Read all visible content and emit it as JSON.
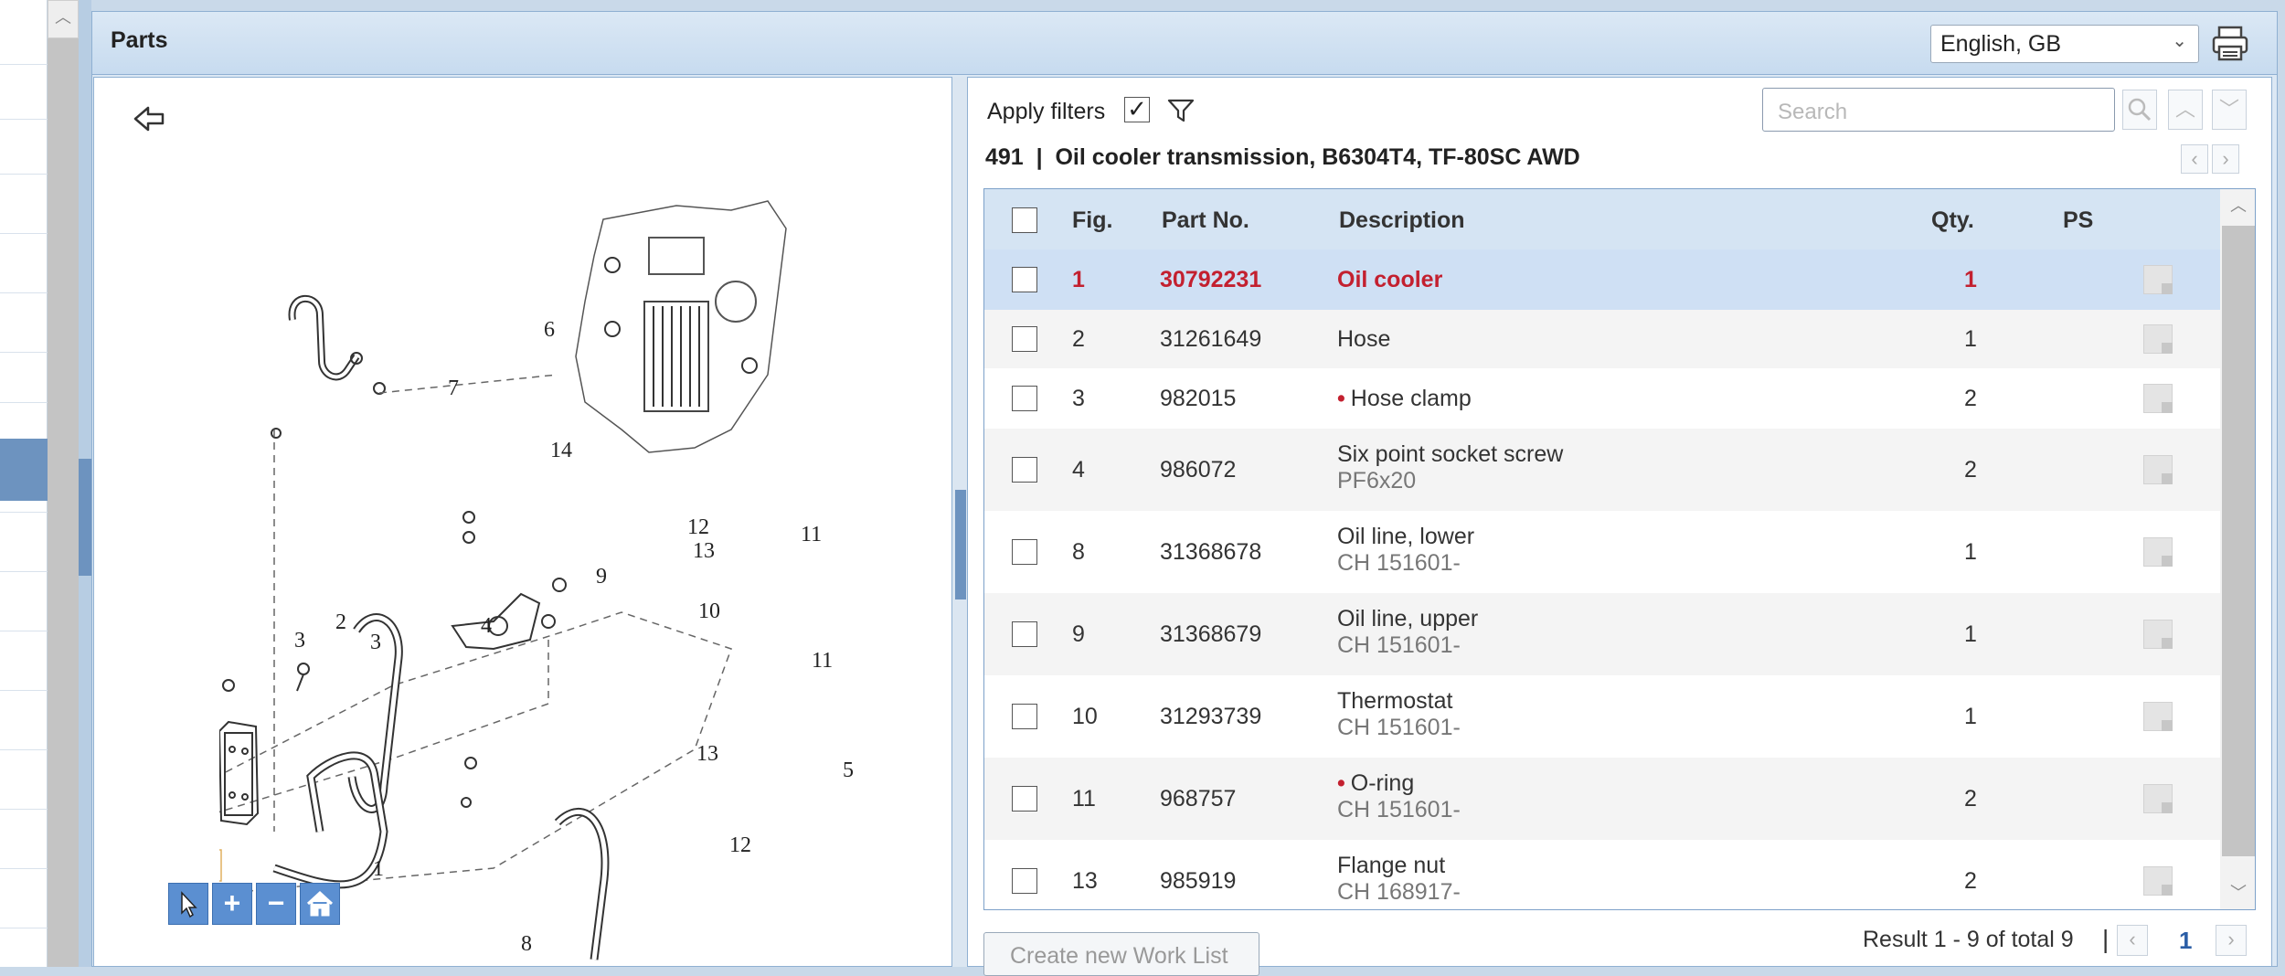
{
  "header": {
    "title": "Parts",
    "language": "English, GB"
  },
  "filters": {
    "apply_label": "Apply filters",
    "apply_checked": true,
    "search_placeholder": "Search"
  },
  "part": {
    "title": "491  |  Oil cooler transmission, B6304T4, TF-80SC AWD"
  },
  "table": {
    "columns": [
      "Fig.",
      "Part No.",
      "Description",
      "Qty.",
      "PS"
    ],
    "rows": [
      {
        "fig": "1",
        "part_no": "30792231",
        "desc": "Oil cooler",
        "sub": "",
        "qty": "1",
        "dot": false,
        "selected": true
      },
      {
        "fig": "2",
        "part_no": "31261649",
        "desc": "Hose",
        "sub": "",
        "qty": "1",
        "dot": false,
        "selected": false
      },
      {
        "fig": "3",
        "part_no": "982015",
        "desc": "Hose clamp",
        "sub": "",
        "qty": "2",
        "dot": true,
        "selected": false
      },
      {
        "fig": "4",
        "part_no": "986072",
        "desc": "Six point socket screw",
        "sub": "PF6x20",
        "qty": "2",
        "dot": false,
        "selected": false
      },
      {
        "fig": "8",
        "part_no": "31368678",
        "desc": "Oil line, lower",
        "sub": "CH 151601-",
        "qty": "1",
        "dot": false,
        "selected": false
      },
      {
        "fig": "9",
        "part_no": "31368679",
        "desc": "Oil line, upper",
        "sub": "CH 151601-",
        "qty": "1",
        "dot": false,
        "selected": false
      },
      {
        "fig": "10",
        "part_no": "31293739",
        "desc": "Thermostat",
        "sub": "CH 151601-",
        "qty": "1",
        "dot": false,
        "selected": false
      },
      {
        "fig": "11",
        "part_no": "968757",
        "desc": "O-ring",
        "sub": "CH 151601-",
        "qty": "2",
        "dot": true,
        "selected": false
      },
      {
        "fig": "13",
        "part_no": "985919",
        "desc": "Flange nut",
        "sub": "CH 168917-",
        "qty": "2",
        "dot": false,
        "selected": false
      }
    ]
  },
  "footer": {
    "worklist_label": "Create new Work List",
    "result": "Result 1 - 9 of total 9",
    "separator": "|",
    "page": "1"
  },
  "diagram": {
    "callouts": [
      "6",
      "7",
      "14",
      "12",
      "13",
      "11",
      "9",
      "10",
      "3",
      "2",
      "3",
      "4",
      "11",
      "13",
      "12",
      "5",
      "1",
      "8"
    ]
  },
  "icons": {
    "back": "back-arrow-icon",
    "filter": "filter-icon",
    "print": "printer-icon",
    "search": "search-icon"
  },
  "colors": {
    "accent": "#6d93bf",
    "highlight_text": "#c3202f",
    "header_bg": "#d5e4f3",
    "selected_row": "#cfe0f4"
  }
}
